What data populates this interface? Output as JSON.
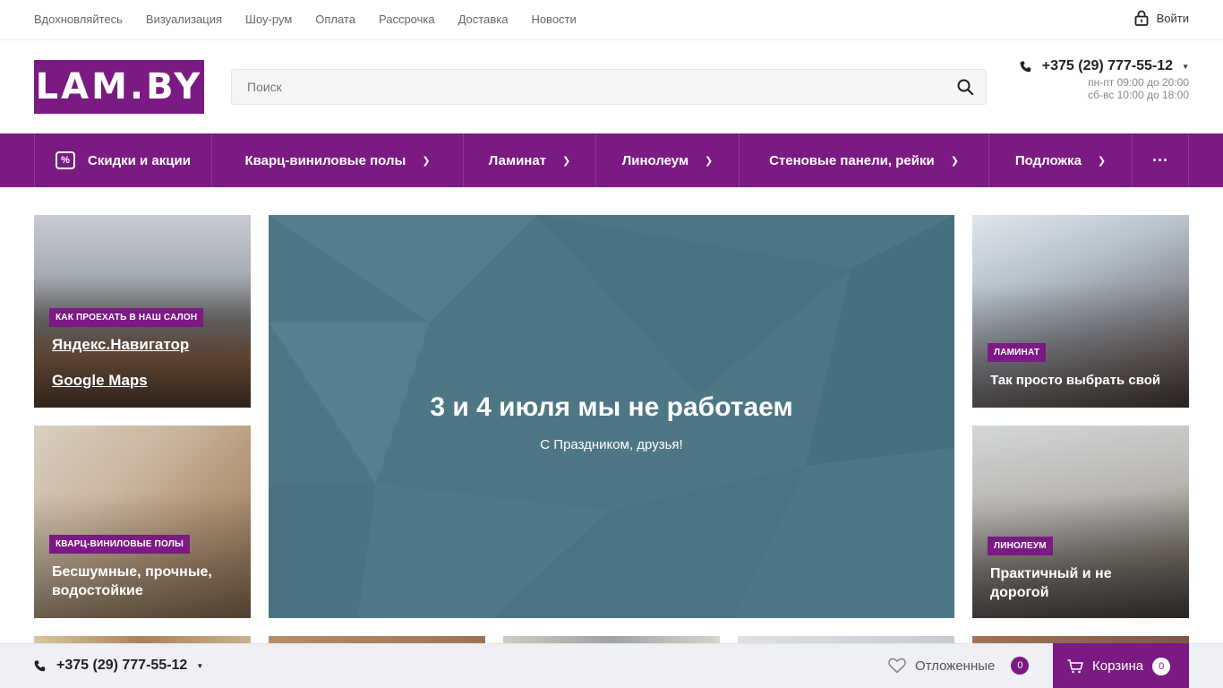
{
  "topnav": [
    "Вдохновляйтесь",
    "Визуализация",
    "Шоу-рум",
    "Оплата",
    "Рассрочка",
    "Доставка",
    "Новости"
  ],
  "login_label": "Войти",
  "logo_text": "LAM.BY",
  "search": {
    "placeholder": "Поиск"
  },
  "phone": {
    "number": "+375 (29) 777-55-12",
    "hours_weekday": "пн-пт 09:00 до 20:00",
    "hours_weekend": "сб-вс 10:00 до 18:00"
  },
  "mainnav": {
    "sale": "Скидки и акции",
    "items": [
      "Кварц-виниловые полы",
      "Ламинат",
      "Линолеум",
      "Стеновые панели, рейки",
      "Подложка"
    ],
    "more": "···"
  },
  "tiles": {
    "store": {
      "tag": "Как проехать в наш салон",
      "link1": "Яндекс.Навигатор",
      "link2": "Google Maps"
    },
    "vinyl": {
      "tag": "Кварц-виниловые полы",
      "title": "Бесшумные, прочные, водостойкие"
    },
    "laminate": {
      "tag": "Ламинат",
      "title": "Так просто выбрать свой"
    },
    "linoleum": {
      "tag": "Линолеум",
      "title": "Практичный и не дорогой"
    }
  },
  "hero": {
    "title": "3 и 4 июля мы не работаем",
    "subtitle": "С Праздником, друзья!"
  },
  "bottombar": {
    "phone": "+375 (29) 777-55-12",
    "deferred_label": "Отложенные",
    "deferred_count": "0",
    "cart_label": "Корзина",
    "cart_count": "0"
  },
  "colors": {
    "brand": "#7a1a82",
    "hero_bg": "#4e7785"
  }
}
